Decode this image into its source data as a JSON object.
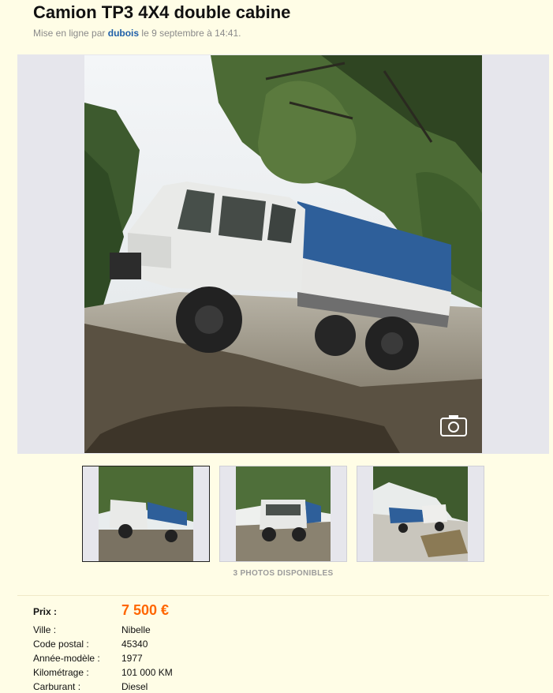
{
  "ad": {
    "title": "Camion TP3 4X4 double cabine",
    "meta_prefix": "Mise en ligne par",
    "author": "dubois",
    "meta_date": "le 9 septembre à 14:41."
  },
  "photos": {
    "count_label": "3 PHOTOS DISPONIBLES",
    "thumbnails": [
      {
        "label": "Camion TP3 vu de face, côté gauche"
      },
      {
        "label": "Camion TP3 vu de face"
      },
      {
        "label": "Camion TP3 en pente dans la forêt"
      }
    ]
  },
  "details": {
    "price": {
      "label": "Prix :",
      "value": "7 500 €"
    },
    "rows": [
      {
        "label": "Ville :",
        "value": "Nibelle"
      },
      {
        "label": "Code postal :",
        "value": "45340"
      },
      {
        "label": "Année-modèle :",
        "value": "1977"
      },
      {
        "label": "Kilométrage :",
        "value": "101 000 KM"
      },
      {
        "label": "Carburant :",
        "value": "Diesel"
      }
    ]
  },
  "colors": {
    "background": "#fffde6",
    "price": "#ff6600",
    "link": "#1f5fa8",
    "truck_tarp": "#2e5f9a"
  },
  "icons": [
    "camera-zoom-icon"
  ]
}
